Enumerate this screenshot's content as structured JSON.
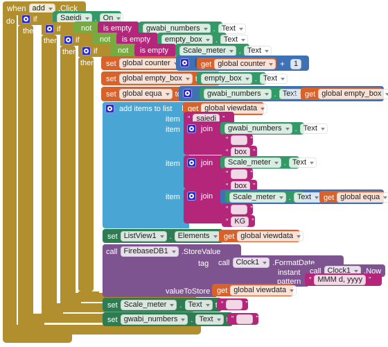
{
  "blocks": {
    "event": {
      "when": "when",
      "component": "add",
      "event": ".Click",
      "do_label": "do"
    },
    "if1": {
      "if": "if",
      "then": "then"
    },
    "if2": {
      "if": "if",
      "then": "then"
    },
    "if3": {
      "if": "if",
      "then": "then"
    },
    "if4": {
      "if": "if",
      "then": "then"
    },
    "cond1": {
      "component": "Saeidi",
      "dot": ".",
      "property": "On"
    },
    "cond2": {
      "not": "not",
      "is_empty": "is empty",
      "component": "gwabi_numbers",
      "dot": ".",
      "property": "Text"
    },
    "cond3": {
      "not": "not",
      "is_empty": "is empty",
      "component": "empty_box",
      "dot": ".",
      "property": "Text"
    },
    "cond4": {
      "not": "not",
      "is_empty": "is empty",
      "component": "Scale_meter",
      "dot": ".",
      "property": "Text"
    },
    "set_counter": {
      "set": "set",
      "variable": "global counter",
      "to": "to",
      "get": "get",
      "get_variable": "global counter",
      "operator": "+",
      "number": "1"
    },
    "set_empty_box": {
      "set": "set",
      "variable": "global empty_box",
      "to": "to",
      "component": "empty_box",
      "dot": ".",
      "property": "Text"
    },
    "set_equa": {
      "set": "set",
      "variable": "global equa",
      "to": "to",
      "component": "gwabi_numbers",
      "dot": ".",
      "property": "Text",
      "operator": "×",
      "get": "get",
      "get_variable": "global empty_box"
    },
    "add_items": {
      "title": "add items to list",
      "list_label": "list",
      "item_label": "item",
      "get": "get",
      "get_variable": "global viewdata",
      "items": [
        {
          "kind": "text",
          "value": "saiedi"
        },
        {
          "kind": "join",
          "join": "join",
          "parts": [
            {
              "kind": "component",
              "component": "gwabi_numbers",
              "dot": ".",
              "property": "Text"
            },
            {
              "kind": "text",
              "value": ""
            },
            {
              "kind": "text",
              "value": "box"
            }
          ]
        },
        {
          "kind": "join",
          "join": "join",
          "parts": [
            {
              "kind": "component",
              "component": "Scale_meter",
              "dot": ".",
              "property": "Text"
            },
            {
              "kind": "text",
              "value": ""
            },
            {
              "kind": "text",
              "value": "box"
            }
          ]
        },
        {
          "kind": "join",
          "join": "join",
          "parts": [
            {
              "kind": "math",
              "component": "Scale_meter",
              "dot": ".",
              "property": "Text",
              "operator": "-",
              "get": "get",
              "get_variable": "global equa"
            },
            {
              "kind": "text",
              "value": ""
            },
            {
              "kind": "text",
              "value": "KG"
            }
          ]
        }
      ]
    },
    "set_listview": {
      "set": "set",
      "component": "ListView1",
      "dot": ".",
      "property": "Elements",
      "to": "to",
      "get": "get",
      "get_variable": "global viewdata"
    },
    "firebase": {
      "call": "call",
      "component": "FirebaseDB1",
      "method": ".StoreValue",
      "tag_label": "tag",
      "tag_call": "call",
      "tag_component": "Clock1",
      "tag_method": ".FormatDate",
      "instant_label": "instant",
      "instant_call": "call",
      "instant_component": "Clock1",
      "instant_method": ".Now",
      "pattern_label": "pattern",
      "pattern_value": "MMM d, yyyy",
      "value_label": "valueToStore",
      "get": "get",
      "get_variable": "global viewdata"
    },
    "set_scale_meter": {
      "set": "set",
      "component": "Scale_meter",
      "dot": ".",
      "property": "Text",
      "to": "to",
      "value": ""
    },
    "set_gwabi": {
      "set": "set",
      "component": "gwabi_numbers",
      "dot": ".",
      "property": "Text",
      "to": "to",
      "value": ""
    }
  },
  "colors": {
    "control": "#B18E2E",
    "logic": "#77AB41",
    "text": "#B4267A",
    "math": "#3F71B5",
    "lists": "#49A6D4",
    "variables": "#D8622B",
    "component_get": "#339966",
    "component_set": "#2E7D52",
    "firebase": "#7D5490"
  }
}
